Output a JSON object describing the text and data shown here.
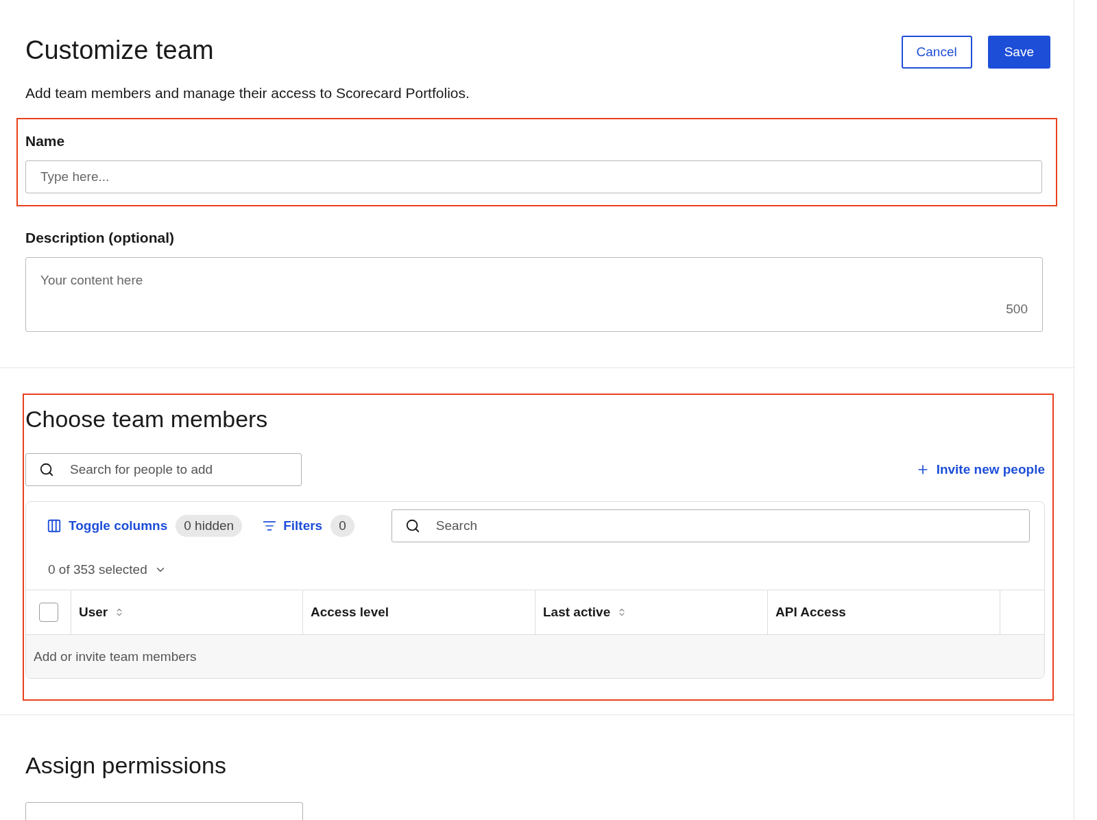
{
  "header": {
    "title": "Customize team",
    "subtitle": "Add team members and manage their access to Scorecard Portfolios.",
    "buttons": [
      {
        "label": "Cancel",
        "kind": "secondary"
      },
      {
        "label": "Save",
        "kind": "primary"
      }
    ]
  },
  "name_field": {
    "label": "Name",
    "placeholder": "Type here...",
    "highlighted": true
  },
  "description_field": {
    "label": "Description (optional)",
    "placeholder": "Your content here",
    "counter": "500"
  },
  "members": {
    "title": "Choose team members",
    "highlighted": true,
    "people_search": {
      "placeholder": "Search for people to add"
    },
    "invite_link": "Invite new people",
    "toolbar": {
      "toggle_columns": "Toggle columns",
      "hidden_badge": "0 hidden",
      "filters": "Filters",
      "filters_count": "0",
      "search": {
        "placeholder": "Search"
      }
    },
    "selection": "0 of 353 selected",
    "table": {
      "select_all_checked": false,
      "columns": [
        {
          "label": "User",
          "sortable": true
        },
        {
          "label": "Access level",
          "sortable": false
        },
        {
          "label": "Last active",
          "sortable": true
        },
        {
          "label": "API Access",
          "sortable": false
        }
      ],
      "empty_text": "Add or invite team members"
    }
  },
  "permissions": {
    "title": "Assign permissions"
  }
}
